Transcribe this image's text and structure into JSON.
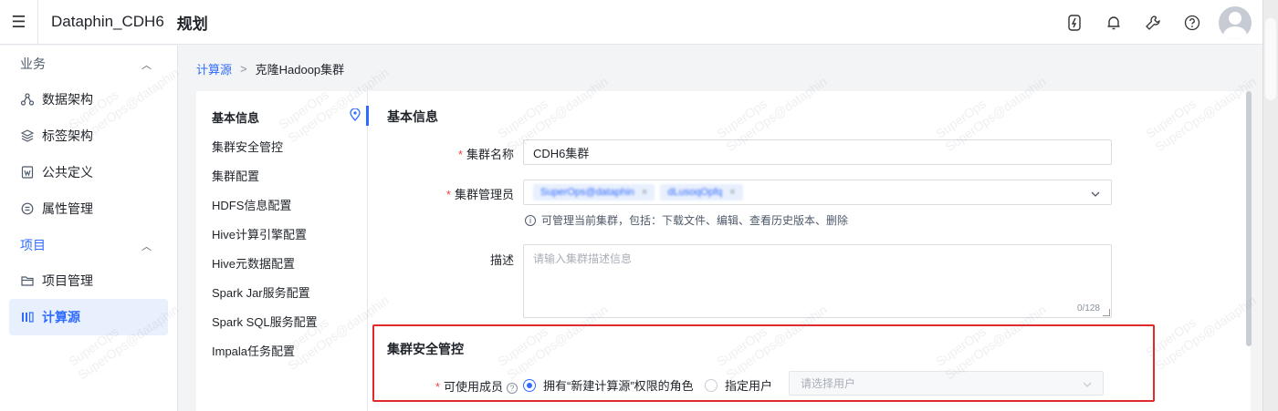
{
  "app": {
    "title": "Dataphin_CDH6",
    "module": "规划"
  },
  "sidebar": {
    "groups": [
      {
        "label": "业务",
        "items": [
          {
            "label": "数据架构",
            "icon": "data-architecture-icon"
          },
          {
            "label": "标签架构",
            "icon": "layers-icon"
          },
          {
            "label": "公共定义",
            "icon": "definition-doc-icon"
          },
          {
            "label": "属性管理",
            "icon": "attribute-icon"
          }
        ]
      },
      {
        "label": "项目",
        "items": [
          {
            "label": "项目管理",
            "icon": "folder-icon"
          },
          {
            "label": "计算源",
            "icon": "compute-source-icon",
            "selected": true
          }
        ]
      }
    ]
  },
  "breadcrumb": {
    "parent": "计算源",
    "current": "克隆Hadoop集群"
  },
  "anchor_nav": [
    "基本信息",
    "集群安全管控",
    "集群配置",
    "HDFS信息配置",
    "Hive计算引擎配置",
    "Hive元数据配置",
    "Spark Jar服务配置",
    "Spark SQL服务配置",
    "Impala任务配置"
  ],
  "basic_info": {
    "title": "基本信息",
    "cluster_name_label": "集群名称",
    "cluster_name_value": "CDH6集群",
    "admin_label": "集群管理员",
    "admin_tags": [
      "SuperOps@dataphin",
      "dLusoqOpfq"
    ],
    "admin_hint": "可管理当前集群，包括：下载文件、编辑、查看历史版本、删除",
    "desc_label": "描述",
    "desc_placeholder": "请输入集群描述信息",
    "desc_counter": "0/128"
  },
  "security": {
    "title": "集群安全管控",
    "members_label": "可使用成员",
    "option_role": "拥有“新建计算源”权限的角色",
    "option_user": "指定用户",
    "user_select_placeholder": "请选择用户"
  },
  "watermark": {
    "line1": "SuperOps",
    "line2": "SuperOps@dataphin"
  },
  "colors": {
    "accent": "#2f6bff",
    "highlight_border": "#e0292b",
    "required": "#f53f3f"
  }
}
